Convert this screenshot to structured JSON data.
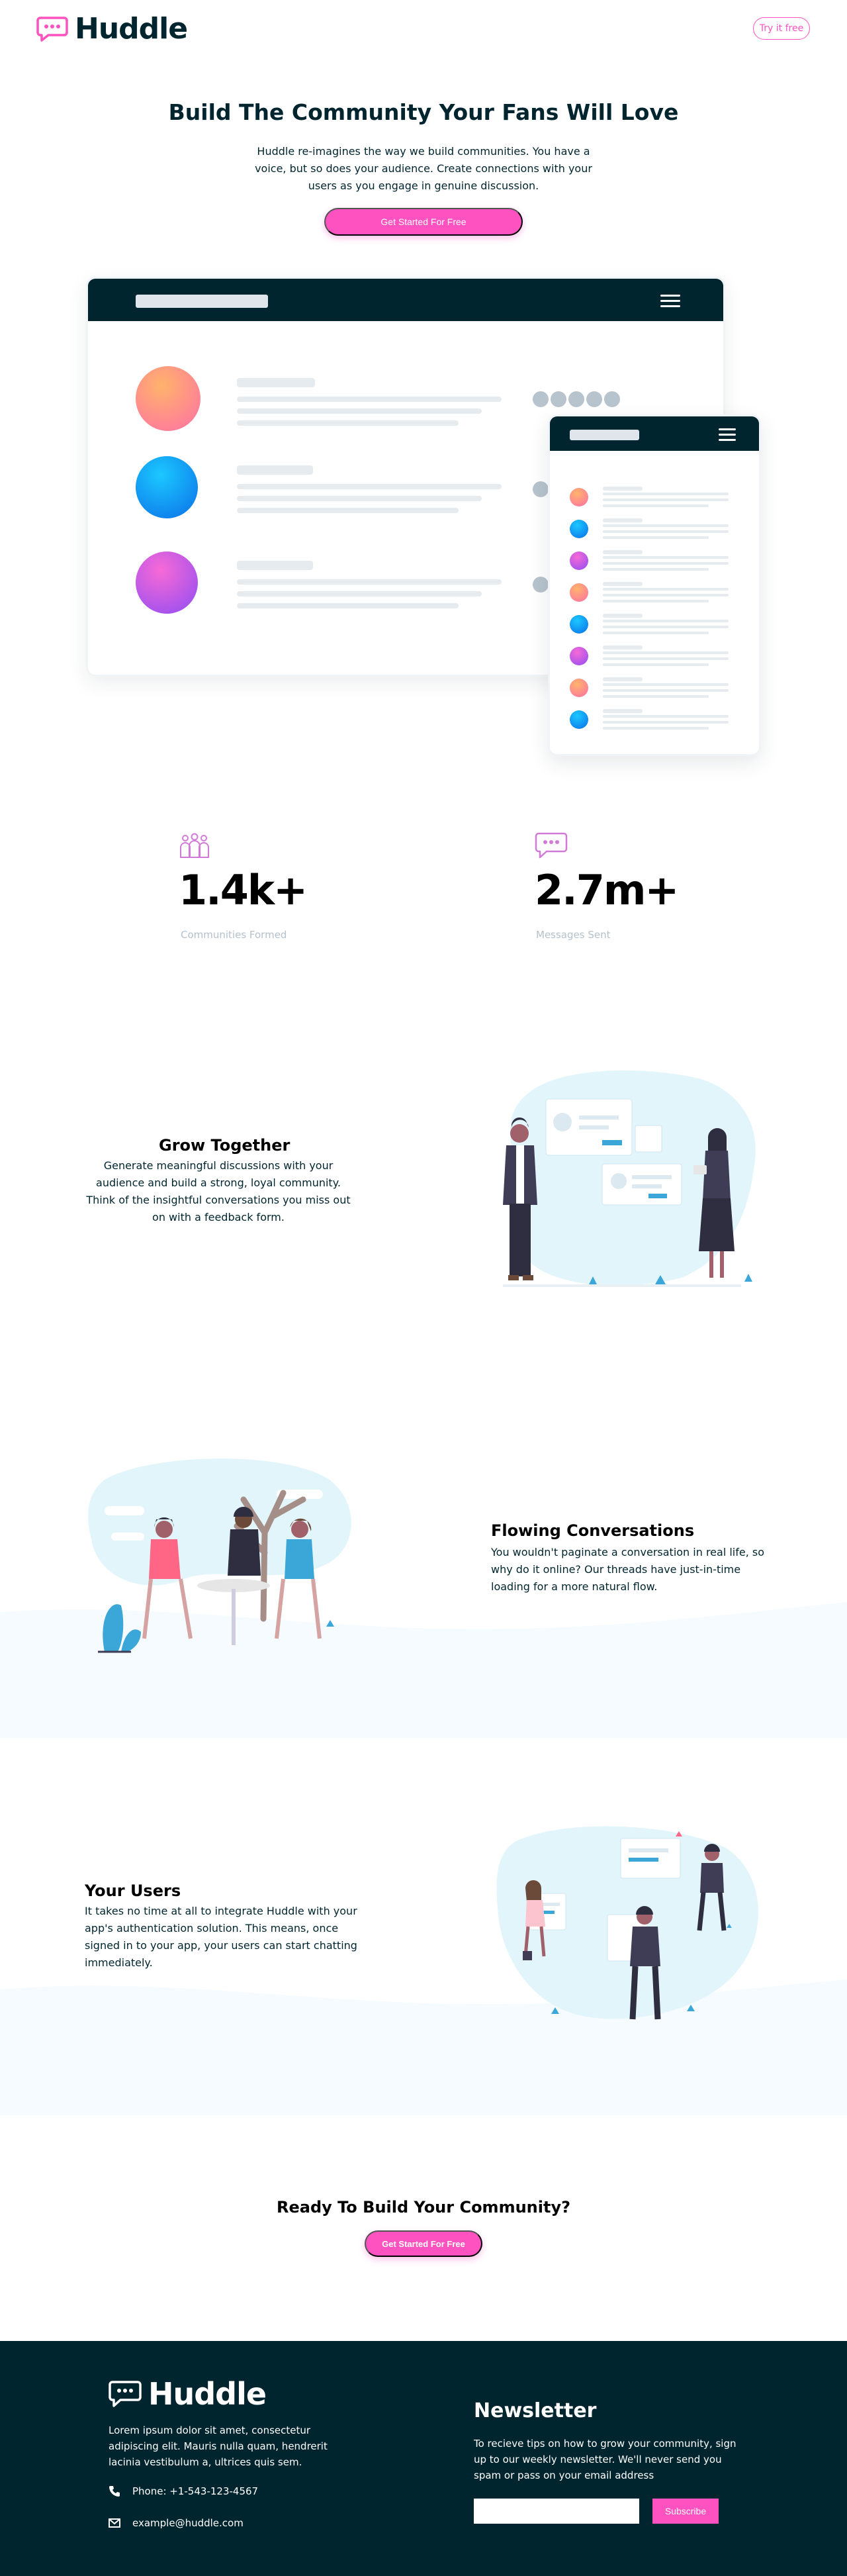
{
  "header": {
    "brand": "Huddle",
    "cta_label": "Try it free"
  },
  "hero": {
    "title": "Build The Community Your Fans Will Love",
    "text": "Huddle re-imagines the way we build communities. You have a voice, but so does your audience. Create connections with your users as you engage in genuine discussion.",
    "cta_label": "Get Started For Free"
  },
  "stats": [
    {
      "value": "1.4k+",
      "label": "Communities Formed",
      "icon": "communities-icon"
    },
    {
      "value": "2.7m+",
      "label": "Messages Sent",
      "icon": "messages-icon"
    }
  ],
  "features": [
    {
      "title": "Grow Together",
      "text": "Generate meaningful discussions with your audience and build a strong, loyal community. Think of the insightful conversations you miss out on with a feedback form."
    },
    {
      "title": "Flowing Conversations",
      "text": "You wouldn't paginate a conversation in real life, so why do it online? Our threads have just-in-time loading for a more natural flow."
    },
    {
      "title": "Your Users",
      "text": "It takes no time at all to integrate Huddle with your app's authentication solution. This means, once signed in to your app, your users can start chatting immediately."
    }
  ],
  "ready": {
    "title": "Ready To Build Your Community?",
    "cta_label": "Get Started For Free"
  },
  "footer": {
    "brand": "Huddle",
    "about": "Lorem ipsum dolor sit amet, consectetur adipiscing elit. Mauris nulla quam, hendrerit lacinia vestibulum a, ultrices quis sem.",
    "phone": "Phone: +1-543-123-4567",
    "email": "example@huddle.com",
    "newsletter_title": "Newsletter",
    "newsletter_text": "To recieve tips on how to grow your community, sign up to our weekly newsletter. We'll never send you spam or pass on your email address",
    "email_input_value": "",
    "subscribe_label": "Subscribe"
  },
  "colors": {
    "dark": "#00252e",
    "pink": "#ff52c1",
    "light_band": "#f5fbff",
    "grey_text": "#b4c1cc"
  }
}
